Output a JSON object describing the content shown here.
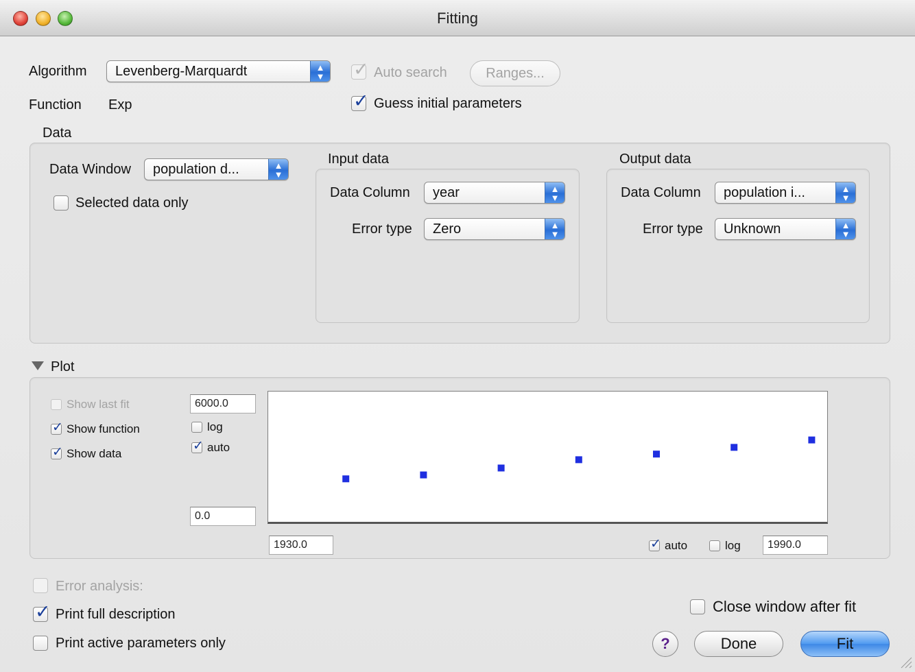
{
  "window": {
    "title": "Fitting"
  },
  "algorithm": {
    "label": "Algorithm",
    "value": "Levenberg-Marquardt"
  },
  "auto_search": {
    "label": "Auto search",
    "checked": true,
    "enabled": false
  },
  "ranges_button": {
    "label": "Ranges...",
    "enabled": false
  },
  "function": {
    "label": "Function",
    "value": "Exp"
  },
  "guess_initial": {
    "label": "Guess initial parameters",
    "checked": true
  },
  "data": {
    "section_label": "Data",
    "data_window_label": "Data Window",
    "data_window_value": "population d...",
    "selected_only_label": "Selected data only",
    "input": {
      "title": "Input data",
      "column_label": "Data Column",
      "column_value": "year",
      "error_label": "Error type",
      "error_value": "Zero"
    },
    "output": {
      "title": "Output data",
      "column_label": "Data Column",
      "column_value": "population i...",
      "error_label": "Error type",
      "error_value": "Unknown"
    }
  },
  "plot": {
    "section_label": "Plot",
    "show_last_fit": "Show last fit",
    "show_function": "Show function",
    "show_data": "Show data",
    "y_max": "6000.0",
    "y_min": "0.0",
    "y_log_label": "log",
    "y_auto_label": "auto",
    "x_min": "1930.0",
    "x_max": "1990.0",
    "x_auto_label": "auto",
    "x_log_label": "log"
  },
  "chart_data": {
    "type": "scatter",
    "x": [
      1930,
      1940,
      1950,
      1960,
      1970,
      1980,
      1990
    ],
    "y": [
      1980,
      2160,
      2480,
      2860,
      3120,
      3430,
      3770
    ],
    "xlim": [
      1920,
      1992
    ],
    "ylim": [
      0,
      6000
    ],
    "color": "#1f2fe0"
  },
  "bottom": {
    "error_analysis": "Error analysis:",
    "print_full": "Print full description",
    "print_active": "Print active parameters only",
    "close_after": "Close window after fit",
    "help": "?",
    "done": "Done",
    "fit": "Fit"
  }
}
